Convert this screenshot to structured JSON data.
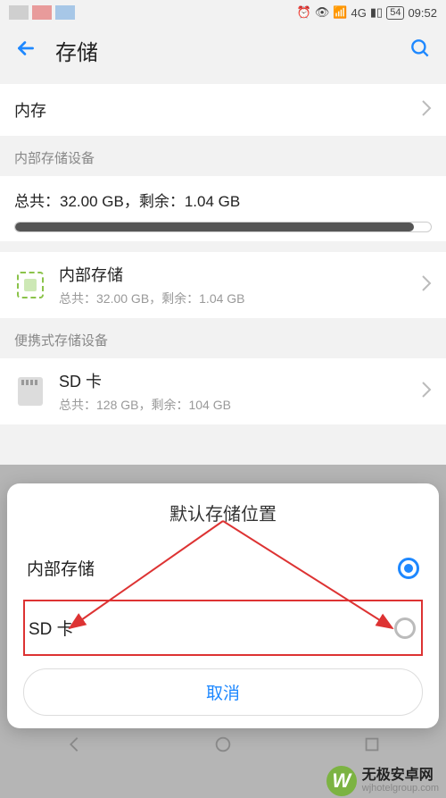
{
  "status": {
    "network_label": "4G",
    "battery": "54",
    "time": "09:52"
  },
  "header": {
    "title": "存储"
  },
  "memory_row": {
    "label": "内存"
  },
  "section_internal_header": "内部存储设备",
  "internal_summary": {
    "line": "总共：32.00 GB，剩余：1.04 GB",
    "used_percent": 96
  },
  "internal_item": {
    "title": "内部存储",
    "sub": "总共：32.00 GB，剩余：1.04 GB"
  },
  "section_portable_header": "便携式存储设备",
  "sd_item": {
    "title": "SD 卡",
    "sub": "总共：128 GB，剩余：104 GB"
  },
  "dialog": {
    "title": "默认存储位置",
    "option_internal": "内部存储",
    "option_sd": "SD 卡",
    "cancel": "取消",
    "selected": "internal"
  },
  "watermark": {
    "brand": "无极安卓网",
    "url": "wjhotelgroup.com"
  }
}
